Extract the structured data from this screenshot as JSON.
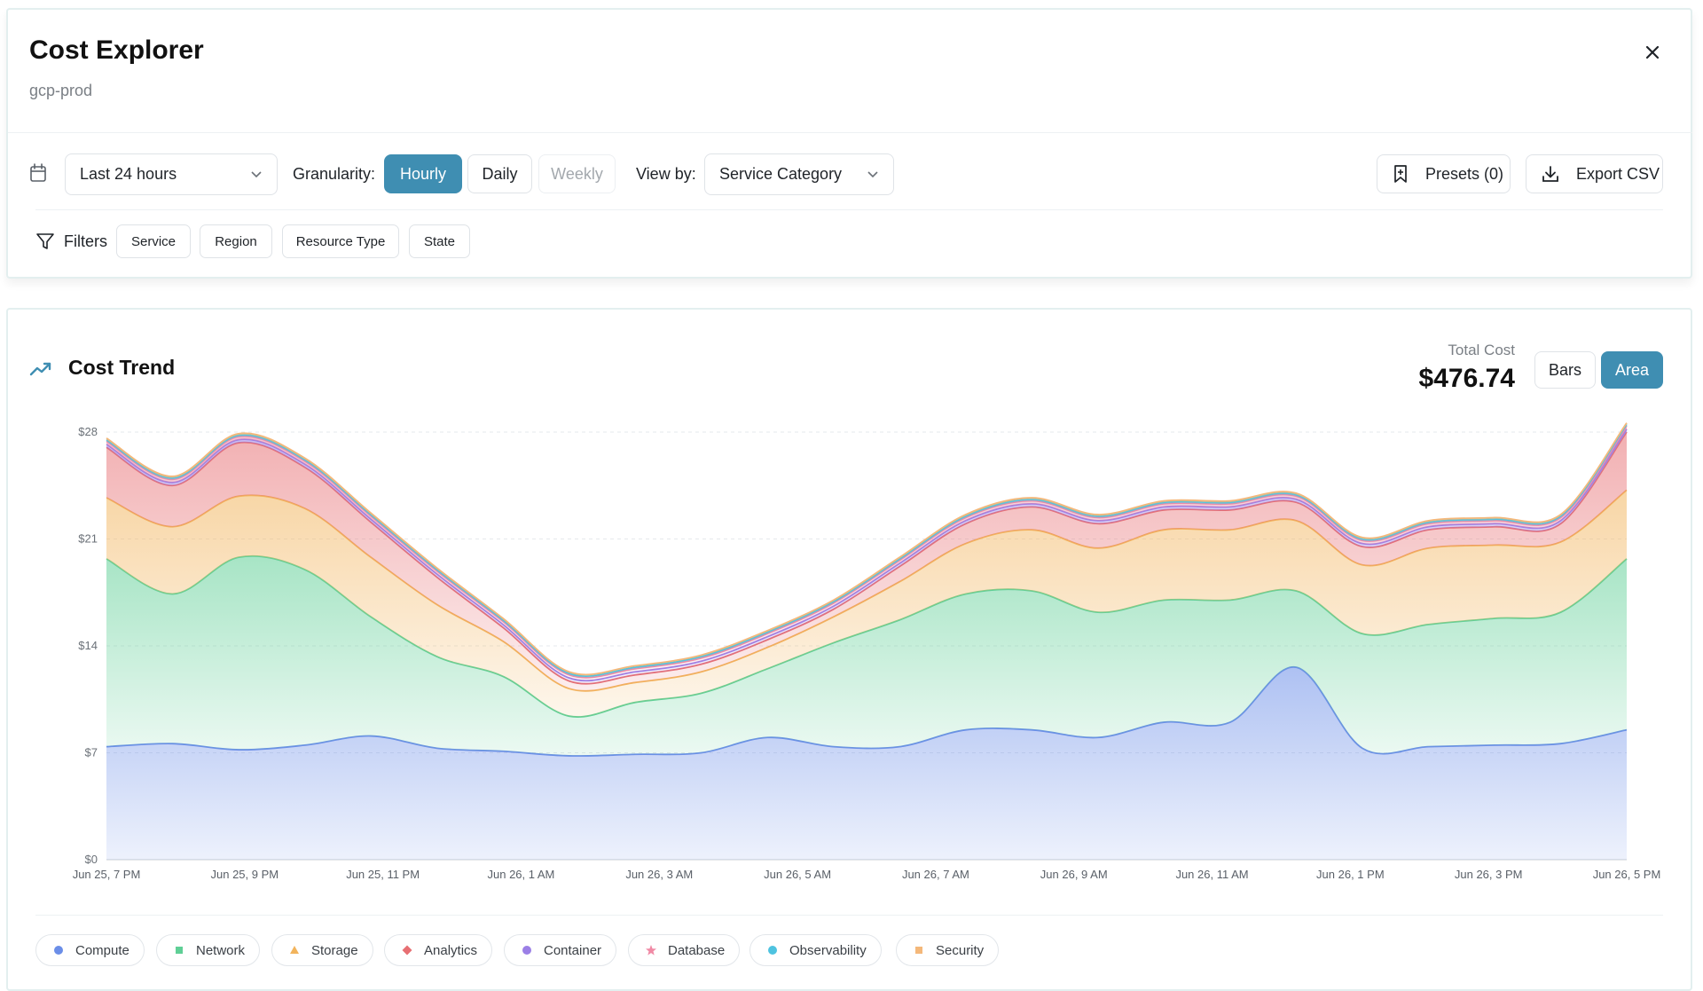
{
  "header": {
    "title": "Cost Explorer",
    "subtitle": "gcp-prod"
  },
  "toolbar": {
    "range": "Last 24 hours",
    "granularity_label": "Granularity:",
    "granularity_options": [
      "Hourly",
      "Daily",
      "Weekly"
    ],
    "granularity_selected": "Hourly",
    "viewby_label": "View by:",
    "viewby": "Service Category",
    "presets": "Presets (0)",
    "export": "Export CSV"
  },
  "filters": {
    "label": "Filters",
    "items": [
      "Service",
      "Region",
      "Resource Type",
      "State"
    ]
  },
  "chart_panel": {
    "title": "Cost Trend",
    "total_label": "Total Cost",
    "total_value": "$476.74",
    "mode_options": [
      "Bars",
      "Area"
    ],
    "mode_selected": "Area"
  },
  "colors": {
    "accent": "#3f8eb2"
  },
  "chart_data": {
    "type": "area",
    "stacked": true,
    "grid": "horizontal dashed",
    "x_tick_labels": [
      "Jun 25, 7 PM",
      "Jun 25, 9 PM",
      "Jun 25, 11 PM",
      "Jun 26, 1 AM",
      "Jun 26, 3 AM",
      "Jun 26, 5 AM",
      "Jun 26, 7 AM",
      "Jun 26, 9 AM",
      "Jun 26, 11 AM",
      "Jun 26, 1 PM",
      "Jun 26, 3 PM",
      "Jun 26, 5 PM"
    ],
    "y_tick_labels": [
      "$0",
      "$7",
      "$14",
      "$21",
      "$28"
    ],
    "ylim": [
      0,
      28
    ],
    "series": [
      {
        "name": "Compute",
        "color": "#6b8ee8",
        "marker": "circle",
        "values": [
          7.4,
          7.6,
          7.2,
          7.5,
          8.1,
          7.3,
          7.1,
          6.8,
          6.9,
          7.0,
          8.0,
          7.4,
          7.4,
          8.5,
          8.5,
          8.0,
          9.0,
          9.0,
          12.6,
          7.3,
          7.4,
          7.5,
          7.6,
          8.5
        ]
      },
      {
        "name": "Network",
        "color": "#5fcf96",
        "marker": "square",
        "values": [
          12.3,
          9.8,
          12.6,
          11.5,
          7.8,
          6.0,
          4.9,
          2.6,
          3.4,
          3.9,
          4.5,
          6.8,
          8.3,
          8.9,
          9.1,
          8.2,
          8.0,
          8.0,
          5.0,
          7.5,
          8.0,
          8.3,
          8.6,
          11.2
        ]
      },
      {
        "name": "Storage",
        "color": "#f2b45c",
        "marker": "triangle",
        "values": [
          4.0,
          4.4,
          4.0,
          4.0,
          3.9,
          3.4,
          2.3,
          1.8,
          1.3,
          1.4,
          1.4,
          1.7,
          2.5,
          3.3,
          4.0,
          4.2,
          4.6,
          4.6,
          4.6,
          4.5,
          5.0,
          4.8,
          4.6,
          4.5
        ]
      },
      {
        "name": "Analytics",
        "color": "#e76f73",
        "marker": "diamond",
        "values": [
          3.3,
          2.7,
          3.5,
          2.7,
          2.3,
          1.8,
          0.9,
          0.5,
          0.5,
          0.5,
          0.5,
          0.5,
          1.0,
          1.3,
          1.5,
          1.6,
          1.3,
          1.3,
          1.2,
          1.2,
          1.2,
          1.2,
          1.2,
          3.8
        ]
      },
      {
        "name": "Container",
        "color": "#9b7fe6",
        "marker": "circle",
        "values": [
          0.2,
          0.2,
          0.2,
          0.2,
          0.2,
          0.2,
          0.2,
          0.2,
          0.2,
          0.2,
          0.2,
          0.2,
          0.2,
          0.2,
          0.2,
          0.2,
          0.2,
          0.2,
          0.2,
          0.2,
          0.2,
          0.2,
          0.2,
          0.2
        ]
      },
      {
        "name": "Database",
        "color": "#f08aa5",
        "marker": "star",
        "values": [
          0.2,
          0.2,
          0.2,
          0.2,
          0.2,
          0.2,
          0.2,
          0.2,
          0.2,
          0.2,
          0.2,
          0.2,
          0.2,
          0.2,
          0.2,
          0.2,
          0.2,
          0.2,
          0.2,
          0.2,
          0.2,
          0.2,
          0.2,
          0.2
        ]
      },
      {
        "name": "Observability",
        "color": "#4ec3e0",
        "marker": "circle",
        "values": [
          0.1,
          0.1,
          0.1,
          0.1,
          0.1,
          0.1,
          0.1,
          0.1,
          0.1,
          0.1,
          0.1,
          0.1,
          0.1,
          0.1,
          0.1,
          0.1,
          0.1,
          0.1,
          0.1,
          0.1,
          0.1,
          0.1,
          0.1,
          0.1
        ]
      },
      {
        "name": "Security",
        "color": "#f4b87a",
        "marker": "square",
        "values": [
          0.1,
          0.1,
          0.1,
          0.1,
          0.1,
          0.1,
          0.1,
          0.1,
          0.1,
          0.1,
          0.1,
          0.1,
          0.1,
          0.1,
          0.1,
          0.1,
          0.1,
          0.1,
          0.1,
          0.1,
          0.1,
          0.1,
          0.1,
          0.1
        ]
      }
    ]
  }
}
